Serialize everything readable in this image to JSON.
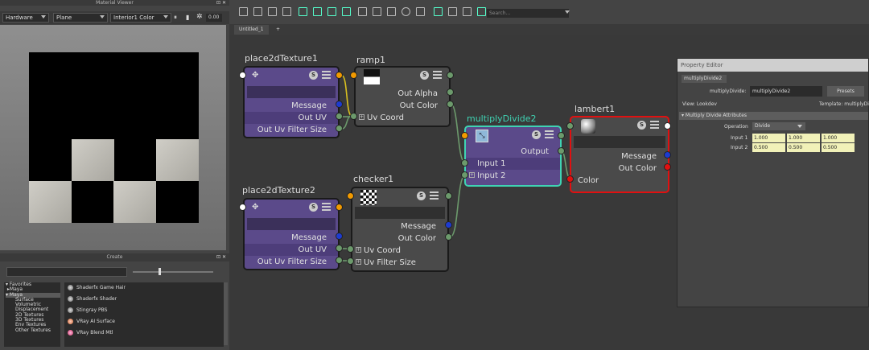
{
  "material_viewer": {
    "title": "Material Viewer",
    "renderer": "Hardware",
    "geometry": "Plane",
    "environment": "Interior1 Color",
    "exposure": "0.00"
  },
  "create_panel": {
    "title": "Create",
    "categories": [
      "Favorites",
      "Maya",
      "Maya",
      "Surface",
      "Volumetric",
      "Displacement",
      "2D Textures",
      "3D Textures",
      "Env Textures",
      "Other Textures"
    ],
    "items": [
      "Shaderfx Game Hair",
      "Shaderfx Shader",
      "Stingray PBS",
      "VRay AI Surface",
      "VRay Blend Mtl"
    ]
  },
  "toolbar": {
    "search_placeholder": "Search..."
  },
  "tabs": [
    "Untitled_1",
    "+"
  ],
  "nodes": {
    "place1": {
      "title": "place2dTexture1",
      "message": "Message",
      "out_uv": "Out UV",
      "out_uv_filter": "Out Uv Filter Size"
    },
    "ramp": {
      "title": "ramp1",
      "out_alpha": "Out Alpha",
      "out_color": "Out Color",
      "uv_coord": "Uv Coord"
    },
    "place2": {
      "title": "place2dTexture2",
      "message": "Message",
      "out_uv": "Out UV",
      "out_uv_filter": "Out Uv Filter Size"
    },
    "checker": {
      "title": "checker1",
      "message": "Message",
      "out_color": "Out Color",
      "uv_coord": "Uv Coord",
      "uv_filter": "Uv Filter Size"
    },
    "multiply": {
      "title": "multiplyDivide2",
      "output": "Output",
      "input1": "Input 1",
      "input2": "Input 2"
    },
    "lambert": {
      "title": "lambert1",
      "message": "Message",
      "out_color": "Out Color",
      "color": "Color"
    }
  },
  "property_editor": {
    "title": "Property Editor",
    "tab": "multiplyDivide2",
    "name_label": "multiplyDivide:",
    "name_value": "multiplyDivide2",
    "presets": "Presets",
    "view_label": "View: Lookdev",
    "template_label": "Template: multiplyDi",
    "section": "Multiply Divide Attributes",
    "operation_label": "Operation",
    "operation_value": "Divide",
    "input1_label": "Input 1",
    "input1": [
      "1.000",
      "1.000",
      "1.000"
    ],
    "input2_label": "Input 2",
    "input2": [
      "0.500",
      "0.500",
      "0.500"
    ]
  },
  "colors": {
    "purple_node": "#5b4a8a",
    "gray_node": "#4a4a4a",
    "multiply_border": "#3fd3b3",
    "lambert_border": "#e01010",
    "selected_title": "#3fd3b3"
  }
}
